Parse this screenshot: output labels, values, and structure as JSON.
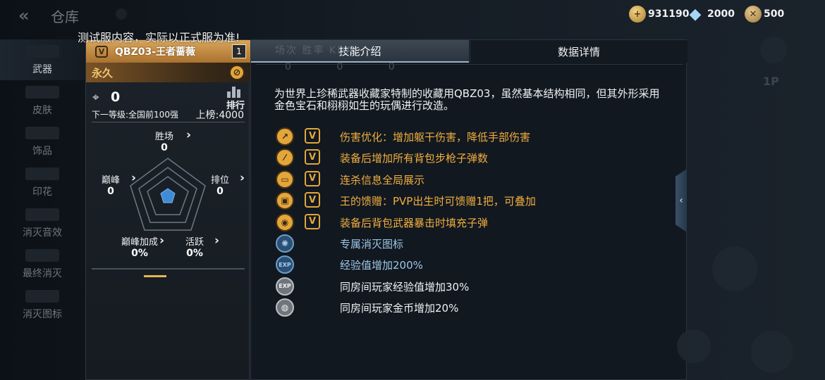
{
  "topbar": {
    "back_icon": "back-arrow-icon",
    "title": "仓库"
  },
  "currencies": {
    "gold": "931190",
    "diamond": "2000",
    "coupon": "500"
  },
  "notice": "测试服内容，实际以正式服为准!",
  "sidebar": {
    "items": [
      {
        "label": "武器",
        "active": true
      },
      {
        "label": "皮肤",
        "active": false
      },
      {
        "label": "饰品",
        "active": false
      },
      {
        "label": "印花",
        "active": false
      },
      {
        "label": "消灭音效",
        "active": false
      },
      {
        "label": "最终消灭",
        "active": false
      },
      {
        "label": "消灭图标",
        "active": false
      }
    ]
  },
  "card": {
    "badge": "V",
    "name": "QBZ03-王者蔷薇",
    "level": "1",
    "duration": "永久",
    "kill_count": "0",
    "rank_label": "排行",
    "next_level": "下一等级:全国前100强",
    "onboard": "上榜:4000",
    "radar": {
      "top": {
        "label": "胜场",
        "value": "0"
      },
      "left": {
        "label": "巅峰",
        "value": "0"
      },
      "right": {
        "label": "排位",
        "value": "0"
      },
      "bottom_left": {
        "label": "巅峰加成",
        "value": "0%"
      },
      "bottom_right": {
        "label": "活跃",
        "value": "0%"
      }
    }
  },
  "panel": {
    "tabs": {
      "skill": "技能介绍",
      "data": "数据详情"
    },
    "ghost_stats": "场次 胜率 KDA",
    "ghost_nums": "0 0 0",
    "description": "为世界上珍稀武器收藏家特制的收藏用QBZ03，虽然基本结构相同，但其外形采用金色宝石和栩栩如生的玩偶进行改造。",
    "skills": [
      {
        "icon": "damage-boost-icon",
        "glyph": "↗",
        "style": "gold",
        "vip": true,
        "text": "伤害优化：增加躯干伤害，降低手部伤害"
      },
      {
        "icon": "ammo-icon",
        "glyph": "⁄",
        "style": "gold",
        "vip": true,
        "text": "装备后增加所有背包步枪子弹数"
      },
      {
        "icon": "killfeed-icon",
        "glyph": "▭",
        "style": "gold",
        "vip": true,
        "text": "连杀信息全局展示"
      },
      {
        "icon": "gift-icon",
        "glyph": "▣",
        "style": "gold",
        "vip": true,
        "text": "王的馈赠：PVP出生时可馈赠1把，可叠加"
      },
      {
        "icon": "crit-refill-icon",
        "glyph": "◉",
        "style": "gold",
        "vip": true,
        "text": "装备后背包武器暴击时填充子弹"
      },
      {
        "icon": "kill-icon-badge",
        "glyph": "✺",
        "style": "blue",
        "vip": false,
        "text": "专属消灭图标"
      },
      {
        "icon": "exp-icon",
        "glyph": "EXP",
        "style": "blue",
        "vip": false,
        "text": "经验值增加200%"
      },
      {
        "icon": "room-exp-icon",
        "glyph": "EXP",
        "style": "grey",
        "vip": false,
        "text": "同房间玩家经验值增加30%"
      },
      {
        "icon": "room-coin-icon",
        "glyph": "◍",
        "style": "grey",
        "vip": false,
        "text": "同房间玩家金币增加20%"
      }
    ]
  },
  "colors": {
    "gold_text": "#f1ae3e",
    "blue_text": "#9ec6e6",
    "header_gold": "#d9a55a"
  }
}
